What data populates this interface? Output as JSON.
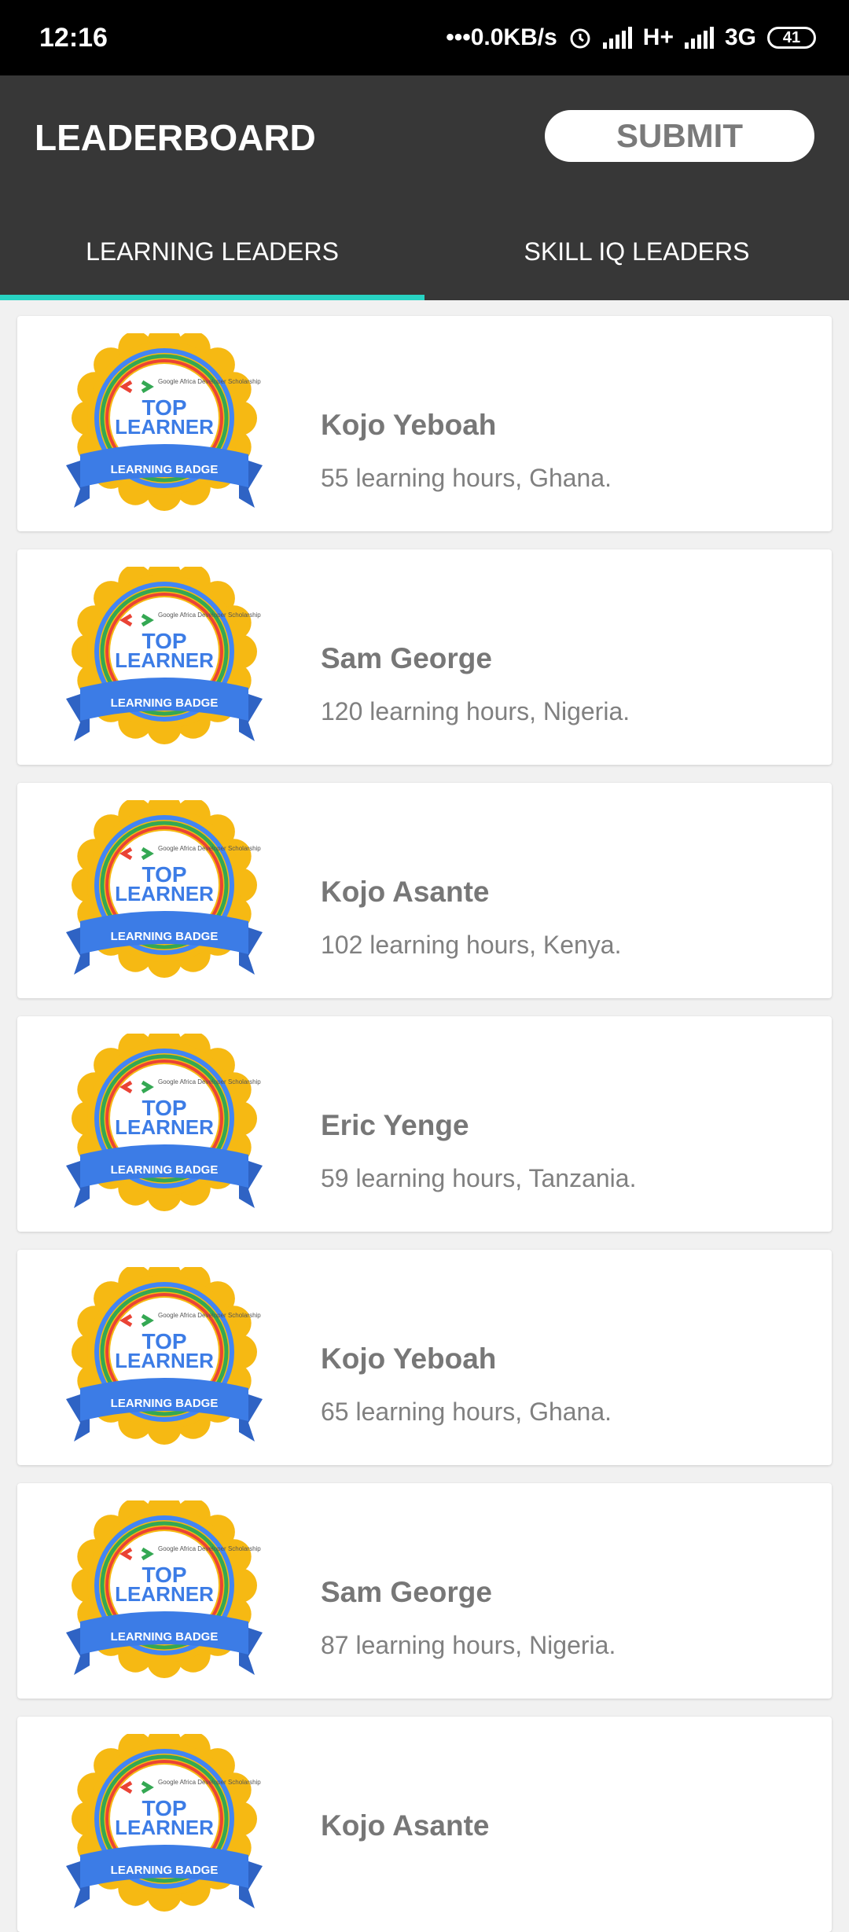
{
  "status_bar": {
    "time": "12:16",
    "speed": "•••0.0KB/s",
    "net1": "H+",
    "net2": "3G",
    "battery": "41"
  },
  "header": {
    "title": "LEADERBOARD",
    "submit_label": "SUBMIT"
  },
  "tabs": [
    {
      "label": "LEARNING LEADERS",
      "active": true
    },
    {
      "label": "SKILL IQ LEADERS",
      "active": false
    }
  ],
  "badge": {
    "brand": "Google Africa Developer Scholarship",
    "line1": "TOP",
    "line2": "LEARNER",
    "ribbon": "LEARNING BADGE"
  },
  "leaders": [
    {
      "name": "Kojo Yeboah",
      "detail": "55 learning hours, Ghana."
    },
    {
      "name": "Sam George",
      "detail": "120 learning hours, Nigeria."
    },
    {
      "name": "Kojo Asante",
      "detail": "102 learning hours, Kenya."
    },
    {
      "name": "Eric Yenge",
      "detail": "59 learning hours, Tanzania."
    },
    {
      "name": "Kojo Yeboah",
      "detail": "65 learning hours, Ghana."
    },
    {
      "name": "Sam George",
      "detail": "87 learning hours, Nigeria."
    },
    {
      "name": "Kojo Asante",
      "detail": ""
    }
  ],
  "colors": {
    "app_bar": "#373737",
    "tab_indicator": "#28d3c3",
    "badge_gold": "#f6b913",
    "badge_blue": "#3c7ce6"
  }
}
